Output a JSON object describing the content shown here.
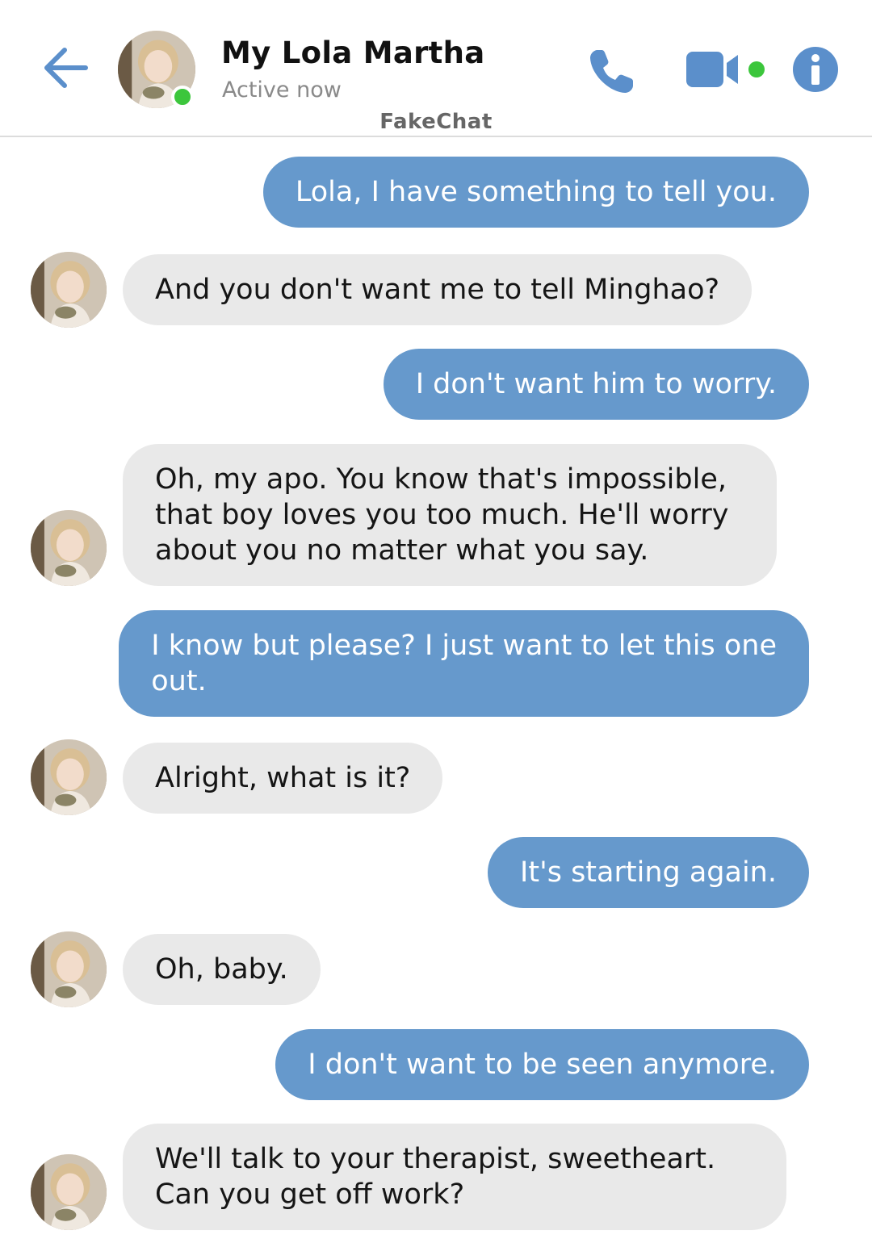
{
  "header": {
    "contact_name": "My Lola Martha",
    "status": "Active now",
    "watermark": "FakeChat",
    "back_icon": "arrow-left-icon",
    "actions": [
      "phone-icon",
      "video-camera-icon",
      "info-icon"
    ],
    "online": true
  },
  "colors": {
    "accent": "#6699cc",
    "sent_bubble": "#6699cc",
    "received_bubble": "#e9e9e9",
    "online": "#3cc63c"
  },
  "messages": [
    {
      "from": "me",
      "text": "Lola, I have something to tell you."
    },
    {
      "from": "contact",
      "text": "And you don't want me to tell Minghao?"
    },
    {
      "from": "me",
      "text": "I don't want him to worry."
    },
    {
      "from": "contact",
      "text": "Oh, my apo. You know that's impossible,\nthat boy loves you too much. He'll worry\nabout you no matter what you say."
    },
    {
      "from": "me",
      "text": "I know but please? I just want to let this one\nout."
    },
    {
      "from": "contact",
      "text": "Alright, what is it?"
    },
    {
      "from": "me",
      "text": "It's starting again."
    },
    {
      "from": "contact",
      "text": "Oh, baby."
    },
    {
      "from": "me",
      "text": "I don't want to be seen anymore."
    },
    {
      "from": "contact",
      "text": "We'll talk to your therapist, sweetheart.\nCan you get off work?"
    }
  ]
}
